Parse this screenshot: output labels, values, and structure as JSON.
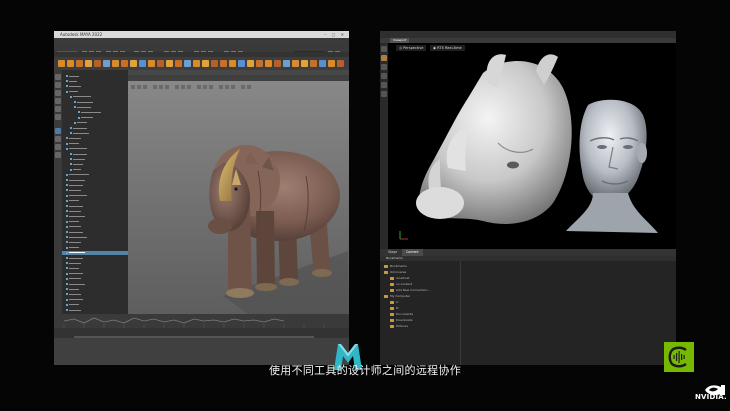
{
  "caption": "使用不同工具的设计师之间的远程协作",
  "maya": {
    "window_title": "Autodesk MAYA 2022",
    "menu": [
      "File",
      "Edit",
      "Create",
      "Select",
      "Modify",
      "Display",
      "Windows",
      "Mesh",
      "Edit Mesh",
      "Mesh Tools",
      "Mesh Display",
      "Curves",
      "Surfaces",
      "Deform",
      "UV",
      "Generate",
      "Cache",
      "Arnold",
      "Help"
    ],
    "shelf_tabs": [
      "Curves / Surfaces",
      "Poly Modeling",
      "Sculpting",
      "Rigging",
      "Animation",
      "Rendering",
      "FX",
      "FX Caching",
      "Custom",
      "Arnold",
      "Bifrost",
      "MASH",
      "Motion Graphics",
      "XGen",
      "Omniverse"
    ],
    "viewport_menu": [
      "View",
      "Shading",
      "Lighting",
      "Show",
      "Renderer",
      "Panels"
    ],
    "outliner_selected": "rhino_mesh"
  },
  "omniverse": {
    "menu": [
      "File",
      "Edit",
      "Create",
      "Window",
      "Animation",
      "Tools",
      "Rendering",
      "Physics",
      "Layout",
      "Help"
    ],
    "viewport_tab": "Viewport",
    "camera_button": "Perspective",
    "render_button": "RTX Real-time",
    "panel_tabs": [
      "Stage",
      "Content"
    ],
    "active_panel": "Content",
    "content_header": "Bookmarks",
    "tree": [
      {
        "label": "Bookmarks",
        "indent": 0
      },
      {
        "label": "Omniverse",
        "indent": 0
      },
      {
        "label": "localhost",
        "indent": 1
      },
      {
        "label": "ov-content",
        "indent": 1
      },
      {
        "label": "Add New Connection...",
        "indent": 1
      },
      {
        "label": "My Computer",
        "indent": 0
      },
      {
        "label": "C:",
        "indent": 1
      },
      {
        "label": "D:",
        "indent": 1
      },
      {
        "label": "Documents",
        "indent": 1
      },
      {
        "label": "Downloads",
        "indent": 1
      },
      {
        "label": "Pictures",
        "indent": 1
      }
    ]
  },
  "logos": {
    "maya_letter": "M",
    "nvidia_text": "NVIDIA."
  },
  "colors": {
    "selection_blue": "#5285a6",
    "nvidia_green": "#76b900",
    "maya_teal": "#2fb7c8"
  }
}
